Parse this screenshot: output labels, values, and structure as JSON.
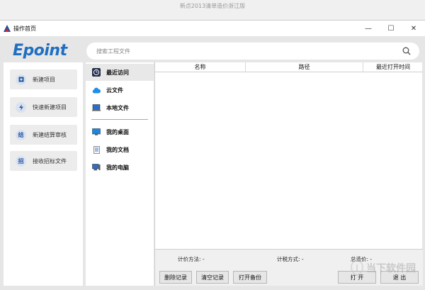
{
  "outer": {
    "title": "新点2013清单造价浙江版"
  },
  "window": {
    "title": "操作首页",
    "controls": {
      "minimize": "—",
      "maximize": "☐",
      "close": "✕"
    }
  },
  "header": {
    "logo": "Epoint",
    "search_placeholder": "搜索工程文件"
  },
  "left_panel": {
    "buttons": [
      {
        "label": "新建项目",
        "icon": "plus-icon"
      },
      {
        "label": "快速新建项目",
        "icon": "lightning-icon"
      },
      {
        "label": "新建结算审核",
        "icon": "结"
      },
      {
        "label": "接收招标文件",
        "icon": "招"
      }
    ]
  },
  "nav": {
    "items": [
      {
        "label": "最近访问",
        "icon": "clock-icon"
      },
      {
        "label": "云文件",
        "icon": "cloud-icon"
      },
      {
        "label": "本地文件",
        "icon": "computer-icon"
      },
      {
        "label": "我的桌面",
        "icon": "desktop-icon"
      },
      {
        "label": "我的文档",
        "icon": "document-icon"
      },
      {
        "label": "我的电脑",
        "icon": "pc-icon"
      }
    ]
  },
  "table": {
    "columns": [
      "名称",
      "路径",
      "最近打开时间"
    ]
  },
  "bottom": {
    "pricing_method": "计价方法: -",
    "tax_method": "计税方式: -",
    "total_cost": "总造价: -",
    "buttons": {
      "delete_record": "删除记录",
      "clear_record": "清空记录",
      "open_backup": "打开备份",
      "open": "打 开",
      "exit": "退 出"
    }
  },
  "watermark": {
    "text": "当下软件园"
  }
}
